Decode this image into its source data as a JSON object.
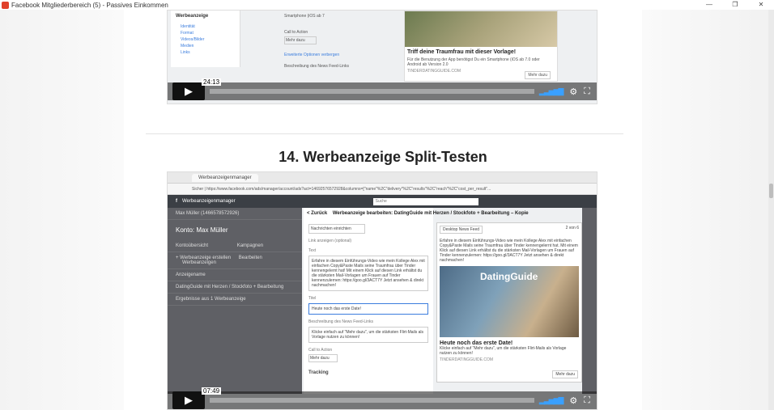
{
  "window": {
    "title": "Facebook Mitgliederbereich (5) - Passives Einkommen",
    "ctrl_min": "—",
    "ctrl_max": "❐",
    "ctrl_close": "✕"
  },
  "video1": {
    "time": "24:13",
    "sidebar_title": "Werbeanzeige",
    "sidebar_items": [
      "Identität",
      "Format",
      "Videos/Bilder",
      "Medien",
      "Links"
    ],
    "smartphone_note": "Smartphone (iOS ab 7",
    "call_to_action": "Call to Action",
    "mehr_dazu": "Mehr dazu",
    "erweiterte": "Erweiterte Optionen verbergen",
    "beschreibung": "Beschreibung des News Feed-Links",
    "ad_caption": "Triff deine Traumfrau mit dieser Vorlage!",
    "ad_desc": "Für die Benutzung der App benötigst Du ein Smartphone (iOS ab 7.0 oder Android ab Version 2.0",
    "ad_domain": "TINDERDATINGGUIDE.COM",
    "ad_button": "Mehr dazu"
  },
  "section_heading": "14. Werbeanzeige Split-Testen",
  "video2": {
    "time": "07:49",
    "browser_tab": "Werbeanzeigenmanager",
    "url": "Sicher | https://www.facebook.com/ads/manager/account/ads?act=14692576572928&columns=[\"name\"%2C\"delivery\"%2C\"results\"%2C\"reach\"%2C\"cost_per_result\"...",
    "fb_app": "Werbeanzeigenmanager",
    "search": "Suche",
    "user": "Max Müller (1466578572926)",
    "account_label": "Konto:",
    "account_name": "Max Müller",
    "kontoubersicht": "Kontoübersicht",
    "kampagnen": "Kampagnen",
    "create_button": "+ Werbeanzeige erstellen",
    "bearbeiten": "Bearbeiten",
    "werbeanzeigen": "Werbeanzeigen",
    "anzeigename": "Anzeigename",
    "row_name": "DatingGuide mit Herzen / Stockfoto + Bearbeitung",
    "results": "Ergebnisse aus 1 Werbeanzeige",
    "back": "< Zurück",
    "editor_title": "Werbeanzeige bearbeiten: DatingGuide mit Herzen / Stockfoto + Bearbeitung – Kopie",
    "nachrichten": "Nachrichten einrichten",
    "link_label": "Link anzeigen (optional)",
    "text_label": "Text",
    "text_body": "Erfahre in diesem Einführungs-Video wie mein Kollege Alex mit einfachen Copy&Paste Mails seine Traumfrau über Tinder kennengelernt hat! Mit einem Klick auf diesen Link erhältst du die stärksten Mail-Vorlagen um Frauen auf Tinder kennenzulernen: https://goo.gl/3ACT7Y Jetzt ansehen & direkt nachmachen!",
    "titel_label": "Titel",
    "titel_value": "Heute noch das erste Date!",
    "beschreibung_label": "Beschreibung des News Feed-Links",
    "beschreibung_value": "Klicke einfach auf \"Mehr dazu\", um die stärksten Flirt-Mails als Vorlage nutzen zu können!",
    "cta_label": "Call to Action",
    "cta_value": "Mehr dazu",
    "tracking": "Tracking",
    "preview_select": "Desktop News Feed",
    "preview_page": "2 von 6",
    "preview_text": "Erfahre in diesem Einführungs-Video wie mein Kollege Alex mit einfachen Copy&Paste Mails seine Traumfrau über Tinder kennengelernt hat. Mit einem Klick auf diesen Link erhältst du die stärksten Mail-Vorlagen um Frauen auf Tinder kennenzulernen: https://goo.gl/3ACT7Y Jetzt ansehen & direkt nachmachen!",
    "photo_label": "DatingGuide",
    "preview_caption": "Heute noch das erste Date!",
    "preview_desc": "Klicke einfach auf \"Mehr dazu\", um die stärksten Flirt-Mails als Vorlage nutzen zu können!",
    "preview_domain": "TINDERDATINGGUIDE.COM",
    "preview_button": "Mehr dazu"
  }
}
